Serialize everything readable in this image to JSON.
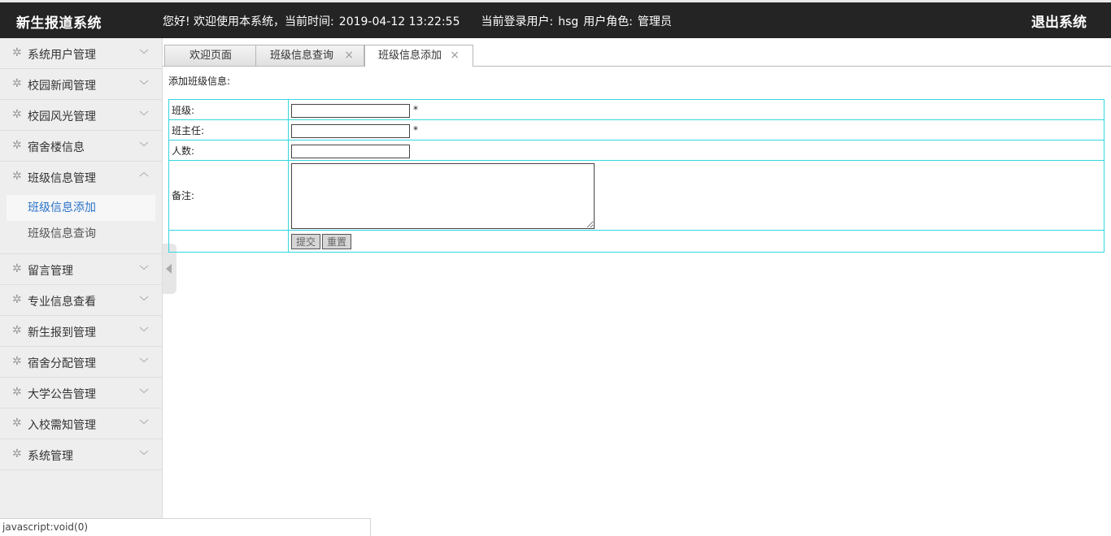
{
  "header": {
    "brand": "新生报道系统",
    "greeting": "您好! 欢迎使用本系统，当前时间:",
    "datetime": "2019-04-12 13:22:55",
    "user_label": "当前登录用户:",
    "username": "hsg",
    "role_label": "用户角色:",
    "role": "管理员",
    "logout": "退出系统"
  },
  "sidebar": {
    "items": [
      {
        "label": "系统用户管理",
        "icon": "gear-icon"
      },
      {
        "label": "校园新闻管理",
        "icon": "gear-icon"
      },
      {
        "label": "校园风光管理",
        "icon": "gear-icon"
      },
      {
        "label": "宿舍楼信息",
        "icon": "gear-icon"
      },
      {
        "label": "班级信息管理",
        "icon": "gear-icon",
        "expanded": true,
        "children": [
          {
            "label": "班级信息添加",
            "active": true
          },
          {
            "label": "班级信息查询"
          }
        ]
      },
      {
        "label": "留言管理",
        "icon": "gear-icon"
      },
      {
        "label": "专业信息查看",
        "icon": "gear-icon"
      },
      {
        "label": "新生报到管理",
        "icon": "gear-icon"
      },
      {
        "label": "宿舍分配管理",
        "icon": "gear-icon"
      },
      {
        "label": "大学公告管理",
        "icon": "gear-icon"
      },
      {
        "label": "入校需知管理",
        "icon": "gear-icon"
      },
      {
        "label": "系统管理",
        "icon": "gear-icon"
      }
    ]
  },
  "tabs": [
    {
      "label": "欢迎页面",
      "closable": false
    },
    {
      "label": "班级信息查询",
      "closable": true,
      "close": "×"
    },
    {
      "label": "班级信息添加",
      "closable": true,
      "close": "×",
      "active": true
    }
  ],
  "form": {
    "title": "添加班级信息:",
    "fields": {
      "class_label": "班级:",
      "class_value": "",
      "teacher_label": "班主任:",
      "teacher_value": "",
      "count_label": "人数:",
      "count_value": "",
      "remark_label": "备注:",
      "remark_value": "",
      "required_mark": "*"
    },
    "submit": "提交",
    "reset": "重置"
  },
  "statusbar": {
    "text": "javascript:void(0)"
  },
  "colors": {
    "header_bg": "#242424",
    "sidebar_bg": "#eeeeee",
    "active_link": "#2b73c9",
    "table_border": "#33d7e0"
  }
}
